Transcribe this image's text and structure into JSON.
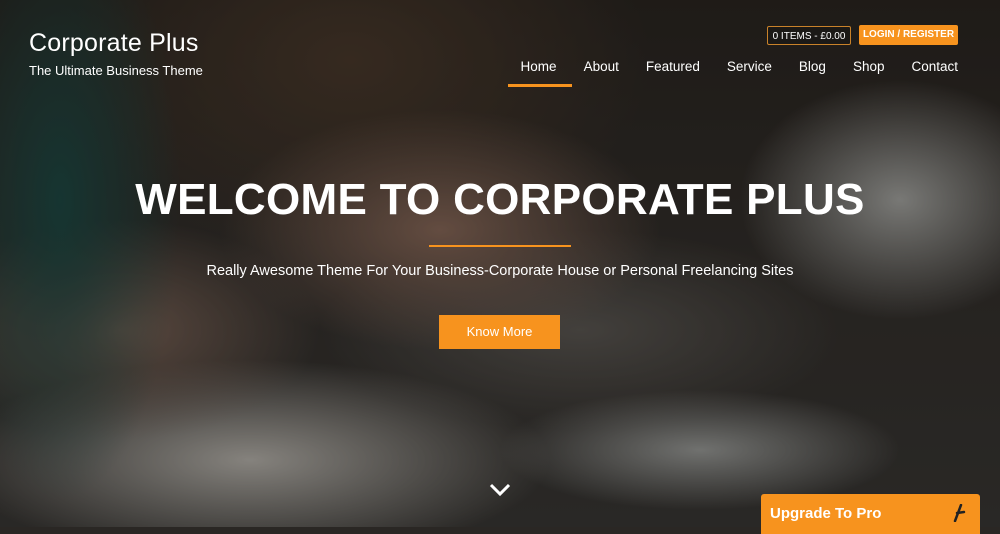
{
  "site": {
    "title": "Corporate Plus",
    "tagline": "The Ultimate Business Theme"
  },
  "header": {
    "cart_label": "0 ITEMS - £0.00",
    "login_label": "LOGIN / REGISTER"
  },
  "nav": {
    "items": [
      {
        "label": "Home",
        "active": true
      },
      {
        "label": "About",
        "active": false
      },
      {
        "label": "Featured",
        "active": false
      },
      {
        "label": "Service",
        "active": false
      },
      {
        "label": "Blog",
        "active": false
      },
      {
        "label": "Shop",
        "active": false
      },
      {
        "label": "Contact",
        "active": false
      }
    ]
  },
  "hero": {
    "headline": "WELCOME TO CORPORATE PLUS",
    "subtitle": "Really Awesome Theme For Your Business-Corporate House or Personal Freelancing Sites",
    "cta_label": "Know More",
    "scroll_icon": "chevron-down-icon"
  },
  "upgrade": {
    "label": "Upgrade To Pro",
    "icon": "pin-icon"
  },
  "colors": {
    "accent": "#f7931e",
    "text": "#ffffff"
  }
}
